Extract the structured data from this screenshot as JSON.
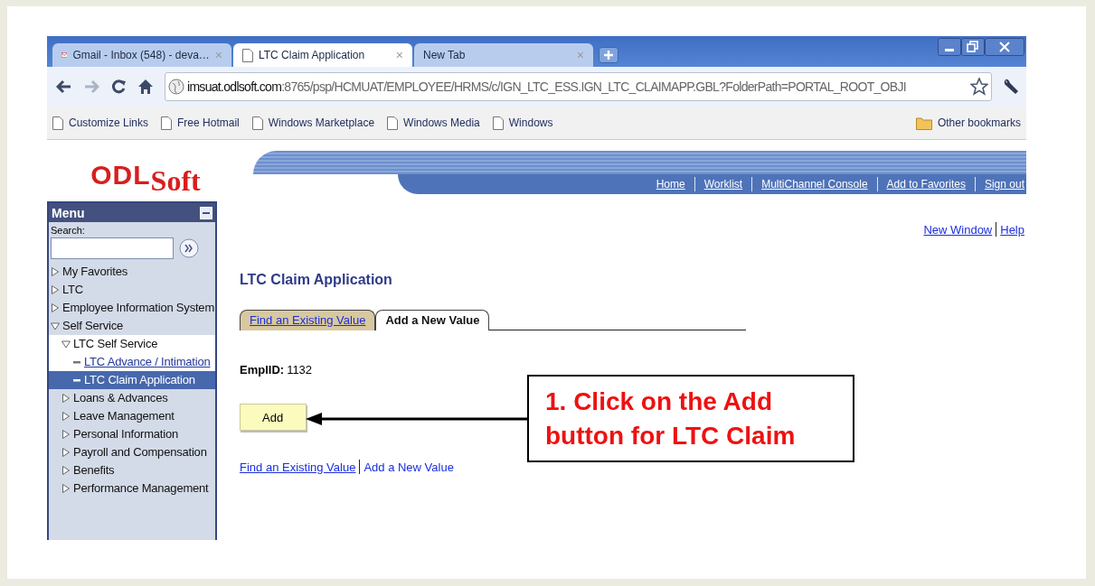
{
  "browser": {
    "tabs": [
      {
        "label": "Gmail - Inbox (548) - deva…",
        "kind": "gmail",
        "selected": false,
        "close": "×"
      },
      {
        "label": "LTC Claim Application",
        "kind": "page",
        "selected": true,
        "close": "×"
      },
      {
        "label": "New Tab",
        "kind": "plain",
        "selected": false,
        "close": "×"
      }
    ],
    "address": {
      "host": "imsuat.odlsoft.com",
      "path": ":8765/psp/HCMUAT/EMPLOYEE/HRMS/c/IGN_LTC_ESS.IGN_LTC_CLAIMAPP.GBL?FolderPath=PORTAL_ROOT_OBJI"
    },
    "bookmarks": [
      "Customize Links",
      "Free Hotmail",
      "Windows Marketplace",
      "Windows Media",
      "Windows"
    ],
    "other_bookmarks": "Other bookmarks"
  },
  "header": {
    "logo_main": "ODL",
    "logo_sub": "Soft",
    "links": [
      "Home",
      "Worklist",
      "MultiChannel Console",
      "Add to Favorites",
      "Sign out"
    ]
  },
  "menu": {
    "title": "Menu",
    "search_label": "Search:",
    "items": [
      {
        "label": "My Favorites",
        "expanded": false
      },
      {
        "label": "LTC",
        "expanded": false
      },
      {
        "label": "Employee Information System",
        "expanded": false
      },
      {
        "label": "Self Service",
        "expanded": true,
        "children": [
          {
            "label": "LTC Self Service",
            "expanded": true,
            "children": [
              {
                "label": "LTC Advance / Intimation",
                "selected": false
              },
              {
                "label": "LTC Claim Application",
                "selected": true
              }
            ]
          },
          {
            "label": "Loans & Advances",
            "expanded": false
          },
          {
            "label": "Leave Management",
            "expanded": false
          },
          {
            "label": "Personal Information",
            "expanded": false
          },
          {
            "label": "Payroll and Compensation",
            "expanded": false
          },
          {
            "label": "Benefits",
            "expanded": false
          },
          {
            "label": "Performance Management",
            "expanded": false
          }
        ]
      }
    ]
  },
  "top_links": [
    "New Window",
    "Help"
  ],
  "page": {
    "title": "LTC Claim Application",
    "tabs": [
      {
        "label": "Find an Existing Value",
        "selected": false
      },
      {
        "label": "Add a New Value",
        "selected": true
      }
    ],
    "field": {
      "label": "EmplID:",
      "value": "1132"
    },
    "add_button": "Add",
    "bottom_links": [
      "Find an Existing Value",
      "Add a New Value"
    ]
  },
  "callout": {
    "text": "1. Click on the Add button for LTC Claim"
  }
}
